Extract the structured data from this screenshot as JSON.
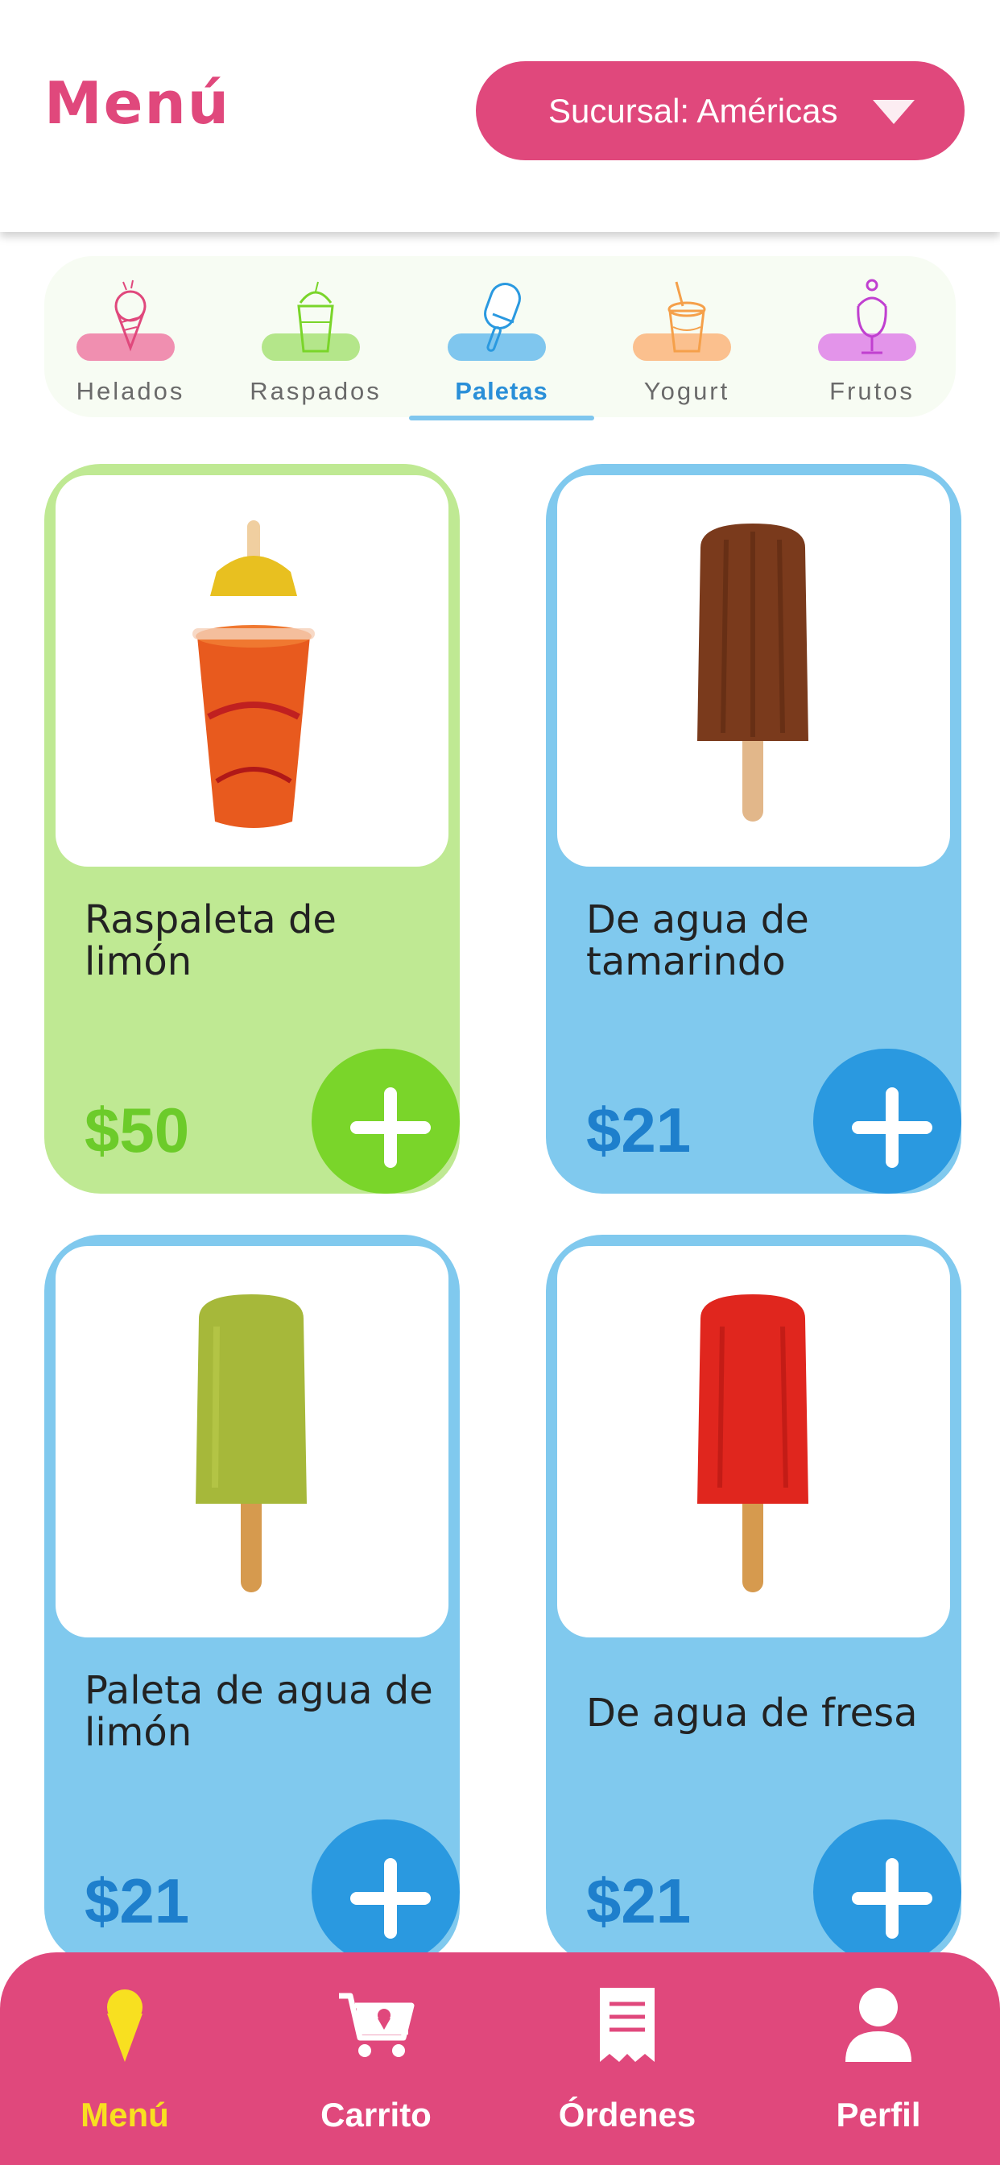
{
  "header": {
    "title": "Menú",
    "branch_label": "Sucursal: Américas"
  },
  "categories": [
    {
      "label": "Helados",
      "icon": "ice-cream-cone-icon",
      "color": "#e0487c"
    },
    {
      "label": "Raspados",
      "icon": "shaved-ice-cup-icon",
      "color": "#7ad52a"
    },
    {
      "label": "Paletas",
      "icon": "popsicle-icon",
      "color": "#2a99e0",
      "active": true
    },
    {
      "label": "Yogurt",
      "icon": "yogurt-cup-icon",
      "color": "#f5a04a"
    },
    {
      "label": "Frutos",
      "icon": "sundae-glass-icon",
      "color": "#c040d0"
    }
  ],
  "products": [
    {
      "name": "Raspaleta de limón",
      "price": "$50",
      "theme": "green"
    },
    {
      "name": "De agua de tamarindo",
      "price": "$21",
      "theme": "blue"
    },
    {
      "name": "Paleta de agua de limón",
      "price": "$21",
      "theme": "blue"
    },
    {
      "name": "De agua de fresa",
      "price": "$21",
      "theme": "blue"
    }
  ],
  "nav": {
    "menu": "Menú",
    "cart": "Carrito",
    "orders": "Órdenes",
    "profile": "Perfil"
  },
  "colors": {
    "brand_pink": "#e0487c",
    "green_card": "#bfe993",
    "blue_card": "#80c9ee",
    "active_nav": "#f8e020"
  }
}
